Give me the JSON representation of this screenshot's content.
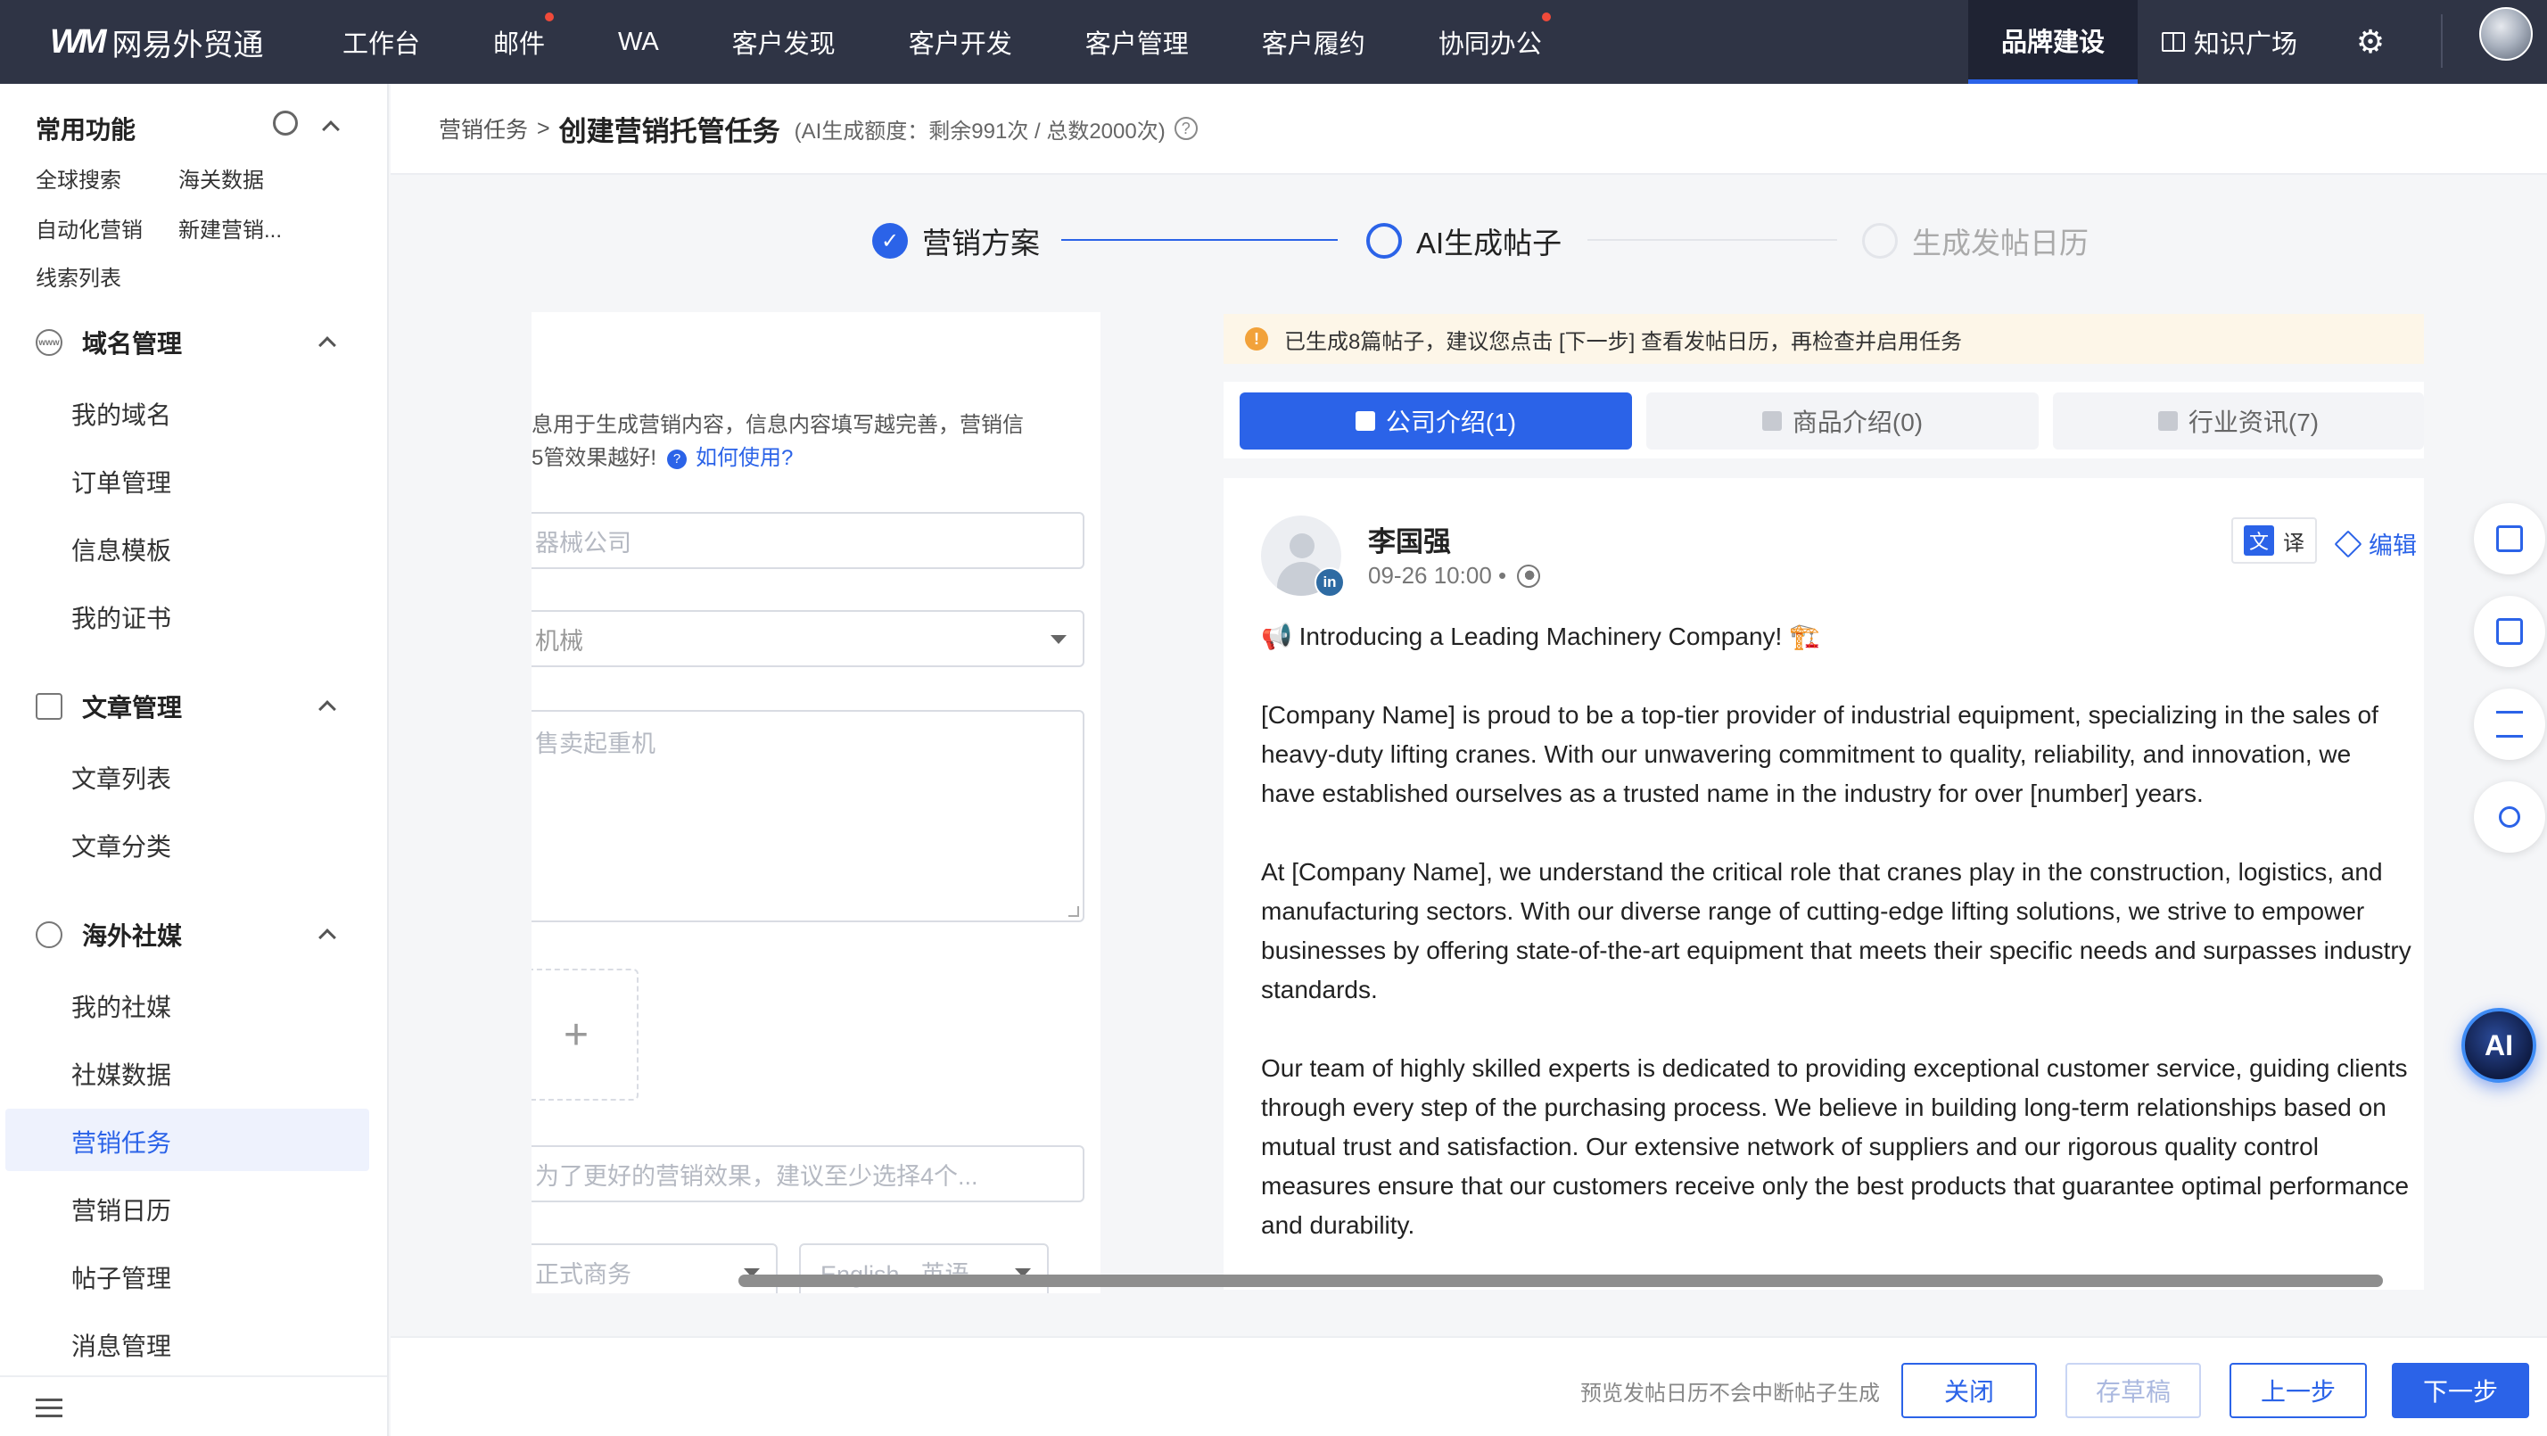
{
  "topnav": {
    "logo_mark": "WM",
    "logo_text": "网易外贸通",
    "items": [
      {
        "label": "工作台",
        "dot": false
      },
      {
        "label": "邮件",
        "dot": true
      },
      {
        "label": "WA",
        "dot": false
      },
      {
        "label": "客户发现",
        "dot": false
      },
      {
        "label": "客户开发",
        "dot": false
      },
      {
        "label": "客户管理",
        "dot": false
      },
      {
        "label": "客户履约",
        "dot": false
      },
      {
        "label": "协同办公",
        "dot": true
      }
    ],
    "brand_tab": "品牌建设",
    "knowledge": "知识广场",
    "settings_icon": "gear-icon",
    "dot_color": "#f04a3a"
  },
  "sidebar": {
    "common_title": "常用功能",
    "quick_links": [
      "全球搜索",
      "海关数据",
      "自动化营销",
      "新建营销...",
      "线索列表"
    ],
    "sections": [
      {
        "title": "域名管理",
        "icon": "www-icon",
        "items": [
          "我的域名",
          "订单管理",
          "信息模板",
          "我的证书"
        ]
      },
      {
        "title": "文章管理",
        "icon": "article-icon",
        "items": [
          "文章列表",
          "文章分类"
        ]
      },
      {
        "title": "海外社媒",
        "icon": "globe-icon",
        "items": [
          "我的社媒",
          "社媒数据",
          "营销任务",
          "营销日历",
          "帖子管理",
          "消息管理"
        ]
      }
    ],
    "active_item": "营销任务"
  },
  "breadcrumb": {
    "parent": "营销任务",
    "separator": ">",
    "title": "创建营销托管任务",
    "quota": "(AI生成额度：剩余991次 / 总数2000次)",
    "help": "?"
  },
  "steps": [
    {
      "label": "营销方案",
      "state": "done"
    },
    {
      "label": "AI生成帖子",
      "state": "current"
    },
    {
      "label": "生成发帖日历",
      "state": "pending"
    }
  ],
  "form": {
    "hint": "息用于生成营销内容，信息内容填写越完善，营销信",
    "hint2": "5管效果越好!",
    "how_to": "如何使用?",
    "company_placeholder": "器械公司",
    "industry_value": "机械",
    "description_placeholder": "售卖起重机",
    "upload_plus": "+",
    "keywords_placeholder": "为了更好的营销效果，建议至少选择4个...",
    "tone_value": "正式商务",
    "language_value": "English - 英语"
  },
  "notice": {
    "icon": "!",
    "text": "已生成8篇帖子，建议您点击 [下一步] 查看发帖日历，再检查并启用任务"
  },
  "tabs": [
    {
      "label": "公司介绍(1)",
      "active": true,
      "icon": "building-icon"
    },
    {
      "label": "商品介绍(0)",
      "active": false,
      "icon": "box-icon"
    },
    {
      "label": "行业资讯(7)",
      "active": false,
      "icon": "doc-icon"
    }
  ],
  "post": {
    "author": "李国强",
    "time": "09-26 10:00 •",
    "platform_badge": "in",
    "translate_icon_label": "文",
    "translate_label": "译",
    "edit_label": "编辑",
    "paragraphs": [
      "📢 Introducing a Leading Machinery Company! 🏗️",
      "[Company Name] is proud to be a top-tier provider of industrial equipment, specializing in the sales of heavy-duty lifting cranes. With our unwavering commitment to quality, reliability, and innovation, we have established ourselves as a trusted name in the industry for over [number] years.",
      "At [Company Name], we understand the critical role that cranes play in the construction, logistics, and manufacturing sectors. With our diverse range of cutting-edge lifting solutions, we strive to empower businesses by offering state-of-the-art equipment that meets their specific needs and surpasses industry standards.",
      "Our team of highly skilled experts is dedicated to providing exceptional customer service, guiding clients through every step of the purchasing process. We believe in building long-term relationships based on mutual trust and satisfaction. Our extensive network of suppliers and our rigorous quality control measures ensure that our customers receive only the best products that guarantee optimal performance and durability."
    ]
  },
  "floating_tools": [
    "clipboard-icon",
    "book-icon",
    "list-icon",
    "user-icon"
  ],
  "ai_button": "AI",
  "footer": {
    "hint": "预览发帖日历不会中断帖子生成",
    "close": "关闭",
    "draft": "存草稿",
    "prev": "上一步",
    "next": "下一步"
  },
  "colors": {
    "accent": "#2b63e8",
    "nav_bg": "#2f3445",
    "notice_bg": "#fdf6e8"
  }
}
